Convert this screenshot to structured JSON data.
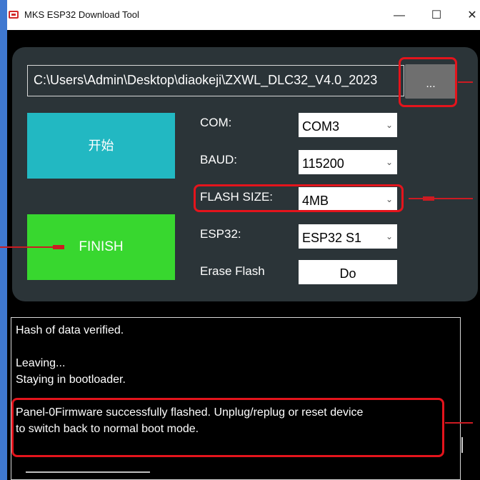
{
  "window": {
    "title": "MKS ESP32 Download Tool",
    "minimize": "—",
    "maximize": "☐",
    "close": "✕"
  },
  "path": {
    "value": "C:\\Users\\Admin\\Desktop\\diaokeji\\ZXWL_DLC32_V4.0_2023",
    "browse_label": "..."
  },
  "buttons": {
    "start": "开始",
    "finish": "FINISH",
    "erase_do": "Do"
  },
  "settings": {
    "com_label": "COM:",
    "com_value": "COM3",
    "baud_label": "BAUD:",
    "baud_value": "115200",
    "flash_size_label": "FLASH SIZE:",
    "flash_size_value": "4MB",
    "esp32_label": "ESP32:",
    "esp32_value": "ESP32 S1",
    "erase_flash_label": "Erase Flash"
  },
  "log": {
    "lines": [
      "Hash of data verified.",
      "",
      "Leaving...",
      "Staying in bootloader.",
      "",
      "Panel-0Firmware successfully flashed. Unplug/replug or reset device",
      "to switch back to normal boot mode."
    ]
  },
  "icons": {
    "dropdown": "chevron-down-icon",
    "app": "usb-icon"
  },
  "colors": {
    "panel": "#2b3438",
    "start_button": "#22b8c2",
    "finish_button": "#38d72f",
    "highlight": "#e4141c",
    "browse_button": "#6f6f6f"
  }
}
